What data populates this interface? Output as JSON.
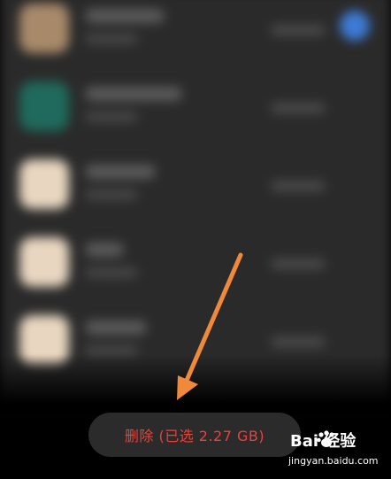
{
  "bottom_bar": {
    "delete_button_label": "删除 (已选 2.27 GB)"
  },
  "colors": {
    "delete_text": "#e8423b",
    "annotation_arrow": "#f08a3a",
    "selected_check": "#3d7bd6"
  },
  "app_list": {
    "rows": [
      {
        "icon_color": "#a88a6a",
        "selected": true
      },
      {
        "icon_color": "#1f6a5c",
        "selected": false
      },
      {
        "icon_color": "#e8d6c0",
        "selected": false
      },
      {
        "icon_color": "#e8d6c0",
        "selected": false
      },
      {
        "icon_color": "#e8d6c0",
        "selected": false
      }
    ]
  },
  "watermark": {
    "logo": "Bai  经验",
    "url": "jingyan.baidu.com"
  },
  "icons": {
    "arrow": "annotation-arrow-icon",
    "paw": "baidu-paw-icon"
  }
}
